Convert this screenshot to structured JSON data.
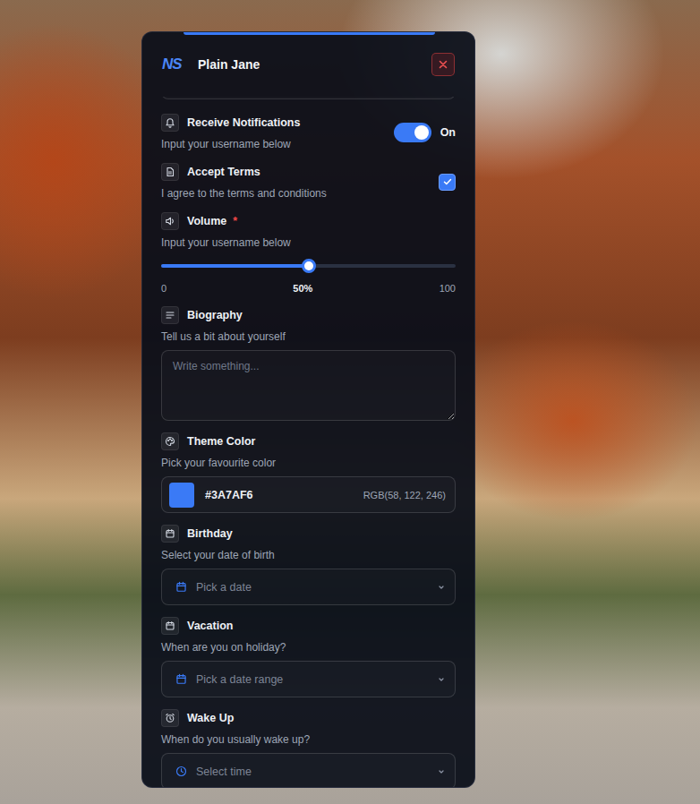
{
  "panel": {
    "logo": "NS",
    "title": "Plain Jane"
  },
  "fields": [
    {
      "kind": "toggle",
      "label": "Receive Notifications",
      "description": "Input your username below",
      "required": false,
      "on": true,
      "state_label": "On"
    },
    {
      "kind": "checkbox",
      "label": "Accept Terms",
      "description": "I agree to the terms and conditions",
      "required": false,
      "checked": true
    },
    {
      "kind": "slider",
      "label": "Volume",
      "description": "Input your username below",
      "required": true,
      "required_mark": "*",
      "level": 0.5,
      "min": "0",
      "reading": "50%",
      "max": "100"
    },
    {
      "kind": "textarea",
      "label": "Biography",
      "description": "Tell us a bit about yourself",
      "required": false,
      "placeholder": "Write something..."
    },
    {
      "kind": "color",
      "label": "Theme Color",
      "description": "Pick your favourite color",
      "required": false,
      "hex": "#3A7AF6",
      "rgb": "RGB(58, 122, 246)",
      "color": "#3a7af6"
    },
    {
      "kind": "date",
      "label": "Birthday",
      "description": "Select your date of birth",
      "required": false,
      "placeholder": "Pick a date"
    },
    {
      "kind": "daterange",
      "label": "Vacation",
      "description": "When are you on holiday?",
      "required": false,
      "placeholder": "Pick a date range"
    },
    {
      "kind": "time",
      "label": "Wake Up",
      "description": "When do you usually wake up?",
      "required": false,
      "placeholder": "Select time"
    }
  ]
}
